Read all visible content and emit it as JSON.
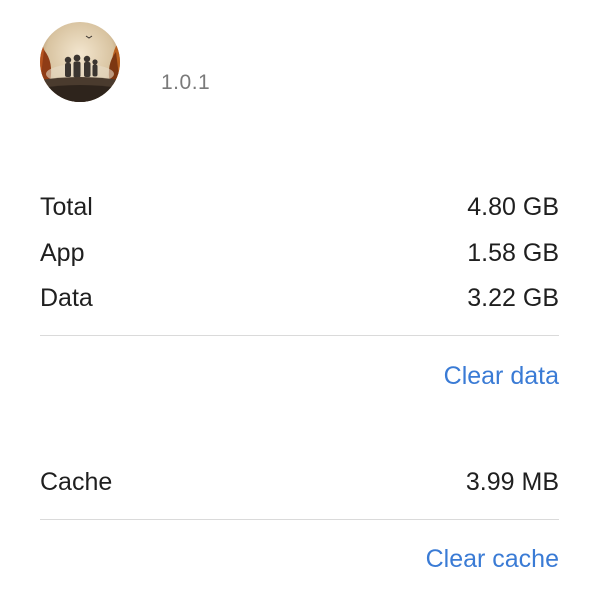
{
  "app": {
    "icon": "app-artwork-icon",
    "version": "1.0.1"
  },
  "storage": {
    "rows": [
      {
        "label": "Total",
        "value": "4.80 GB"
      },
      {
        "label": "App",
        "value": "1.58 GB"
      },
      {
        "label": "Data",
        "value": "3.22 GB"
      }
    ],
    "clear_data_label": "Clear data"
  },
  "cache": {
    "label": "Cache",
    "value": "3.99 MB",
    "clear_cache_label": "Clear cache"
  },
  "colors": {
    "accent": "#3a7bd5",
    "text_primary": "#1f1f1f",
    "text_secondary": "#7a7a7a",
    "divider": "#dadada"
  }
}
